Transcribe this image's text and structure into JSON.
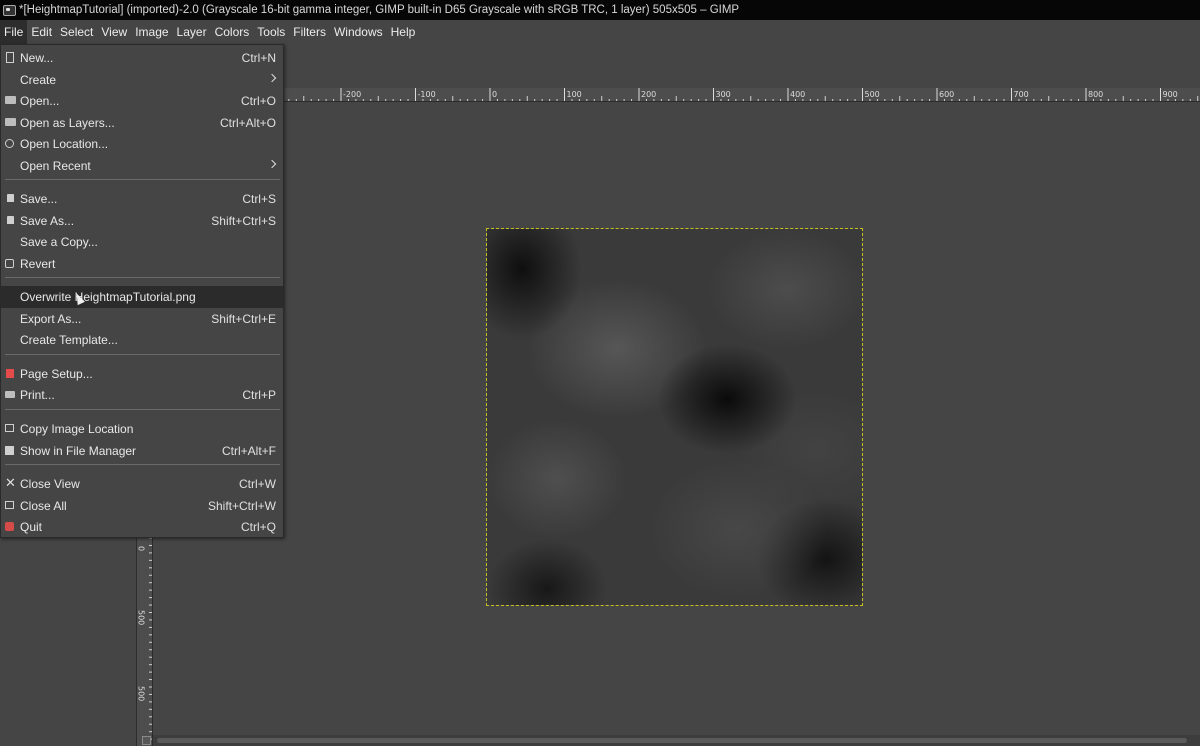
{
  "window": {
    "title": "*[HeightmapTutorial] (imported)-2.0 (Grayscale 16-bit gamma integer, GIMP built-in D65 Grayscale with sRGB TRC, 1 layer) 505x505 – GIMP"
  },
  "menubar": {
    "items": [
      "File",
      "Edit",
      "Select",
      "View",
      "Image",
      "Layer",
      "Colors",
      "Tools",
      "Filters",
      "Windows",
      "Help"
    ],
    "active": "File"
  },
  "file_menu": {
    "items": [
      {
        "label": "New...",
        "accel": "Ctrl+N",
        "icon": "new-document-icon"
      },
      {
        "label": "Create",
        "accel": "",
        "icon": "",
        "submenu": true
      },
      {
        "label": "Open...",
        "accel": "Ctrl+O",
        "icon": "open-folder-icon"
      },
      {
        "label": "Open as Layers...",
        "accel": "Ctrl+Alt+O",
        "icon": "open-layers-icon"
      },
      {
        "label": "Open Location...",
        "accel": "",
        "icon": "globe-icon"
      },
      {
        "label": "Open Recent",
        "accel": "",
        "icon": "",
        "submenu": true
      },
      {
        "label": "Save...",
        "accel": "Ctrl+S",
        "icon": "save-icon"
      },
      {
        "label": "Save As...",
        "accel": "Shift+Ctrl+S",
        "icon": "save-as-icon"
      },
      {
        "label": "Save a Copy...",
        "accel": "",
        "icon": ""
      },
      {
        "label": "Revert",
        "accel": "",
        "icon": "revert-icon"
      },
      {
        "label": "Overwrite HeightmapTutorial.png",
        "accel": "",
        "icon": "",
        "hovered": true
      },
      {
        "label": "Export As...",
        "accel": "Shift+Ctrl+E",
        "icon": ""
      },
      {
        "label": "Create Template...",
        "accel": "",
        "icon": ""
      },
      {
        "label": "Page Setup...",
        "accel": "",
        "icon": "page-setup-icon"
      },
      {
        "label": "Print...",
        "accel": "Ctrl+P",
        "icon": "print-icon"
      },
      {
        "label": "Copy Image Location",
        "accel": "",
        "icon": "copy-location-icon"
      },
      {
        "label": "Show in File Manager",
        "accel": "Ctrl+Alt+F",
        "icon": "file-manager-icon"
      },
      {
        "label": "Close View",
        "accel": "Ctrl+W",
        "icon": "close-icon"
      },
      {
        "label": "Close All",
        "accel": "Shift+Ctrl+W",
        "icon": "close-all-icon"
      },
      {
        "label": "Quit",
        "accel": "Ctrl+Q",
        "icon": "quit-icon"
      }
    ]
  },
  "ruler_top": {
    "labels": [
      "-200",
      "-100",
      "0",
      "100",
      "200",
      "300",
      "400",
      "500",
      "600",
      "700",
      "800",
      "900"
    ]
  },
  "ruler_left": {
    "labels": [
      "0",
      "500",
      "500"
    ]
  },
  "colors": {
    "background": "#454545",
    "selection_outline": "#c8c021",
    "menu_hover": "#2b2b2b"
  }
}
